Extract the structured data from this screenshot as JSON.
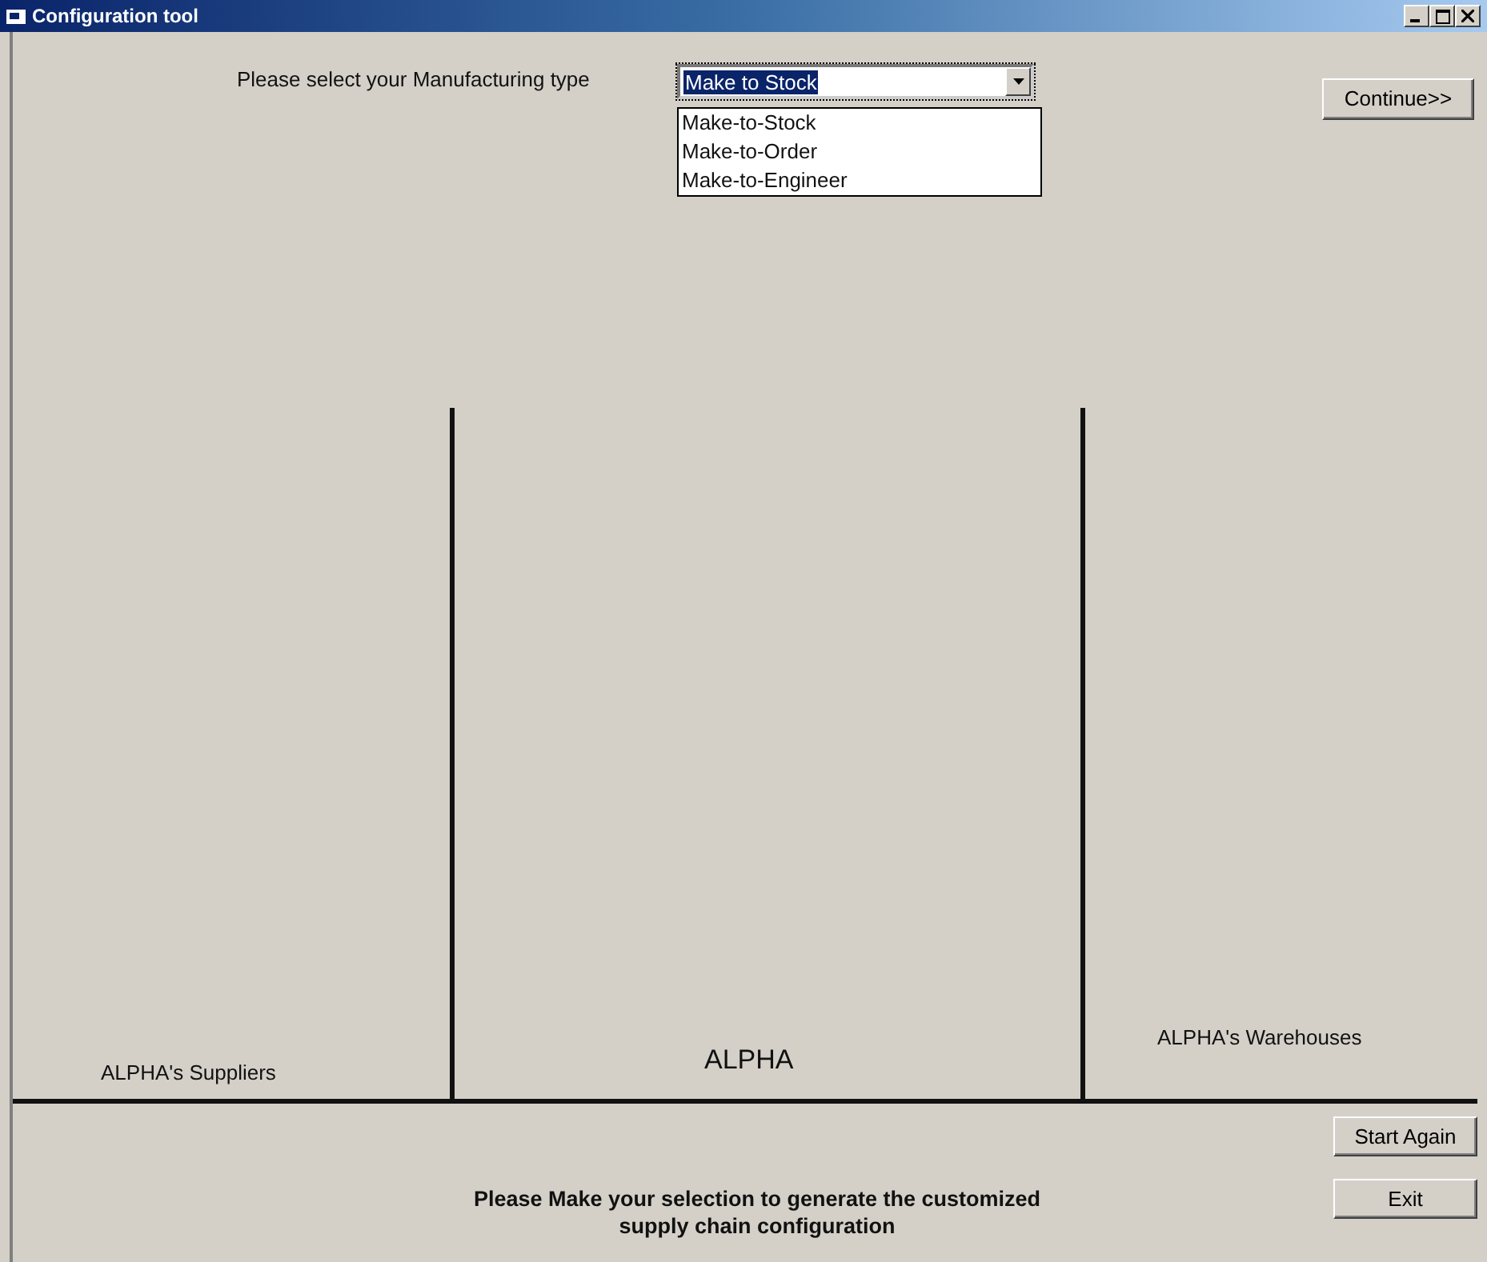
{
  "window": {
    "title": "Configuration tool"
  },
  "manufacturing": {
    "label": "Please select your Manufacturing type",
    "value": "Make to Stock",
    "expanded": true,
    "options": [
      {
        "label": "Make-to-Stock"
      },
      {
        "label": "Make-to-Order"
      },
      {
        "label": "Make-to-Engineer"
      }
    ]
  },
  "continue_button": "Continue>>",
  "diagram": {
    "suppliers": "ALPHA's Suppliers",
    "company": "ALPHA",
    "warehouses": "ALPHA's Warehouses"
  },
  "buttons": [
    "Start Again",
    "Exit"
  ],
  "message": "Please Make your selection to generate the customized supply chain configuration"
}
